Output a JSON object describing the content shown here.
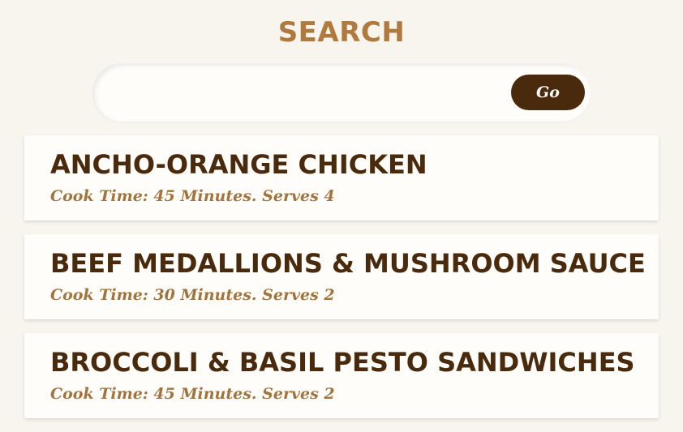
{
  "search": {
    "title": "SEARCH",
    "input_value": "",
    "placeholder": "",
    "go_label": "Go"
  },
  "results": [
    {
      "title": "ANCHO-ORANGE CHICKEN",
      "meta": "Cook Time: 45 Minutes. Serves 4"
    },
    {
      "title": "BEEF MEDALLIONS & MUSHROOM SAUCE",
      "meta": "Cook Time: 30 Minutes. Serves 2"
    },
    {
      "title": "BROCCOLI & BASIL PESTO SANDWICHES",
      "meta": "Cook Time: 45 Minutes. Serves 2"
    }
  ],
  "colors": {
    "background": "#f8f5ee",
    "accent": "#b07a3f",
    "dark_brown": "#4a2a0c",
    "card": "#fffdfa"
  }
}
